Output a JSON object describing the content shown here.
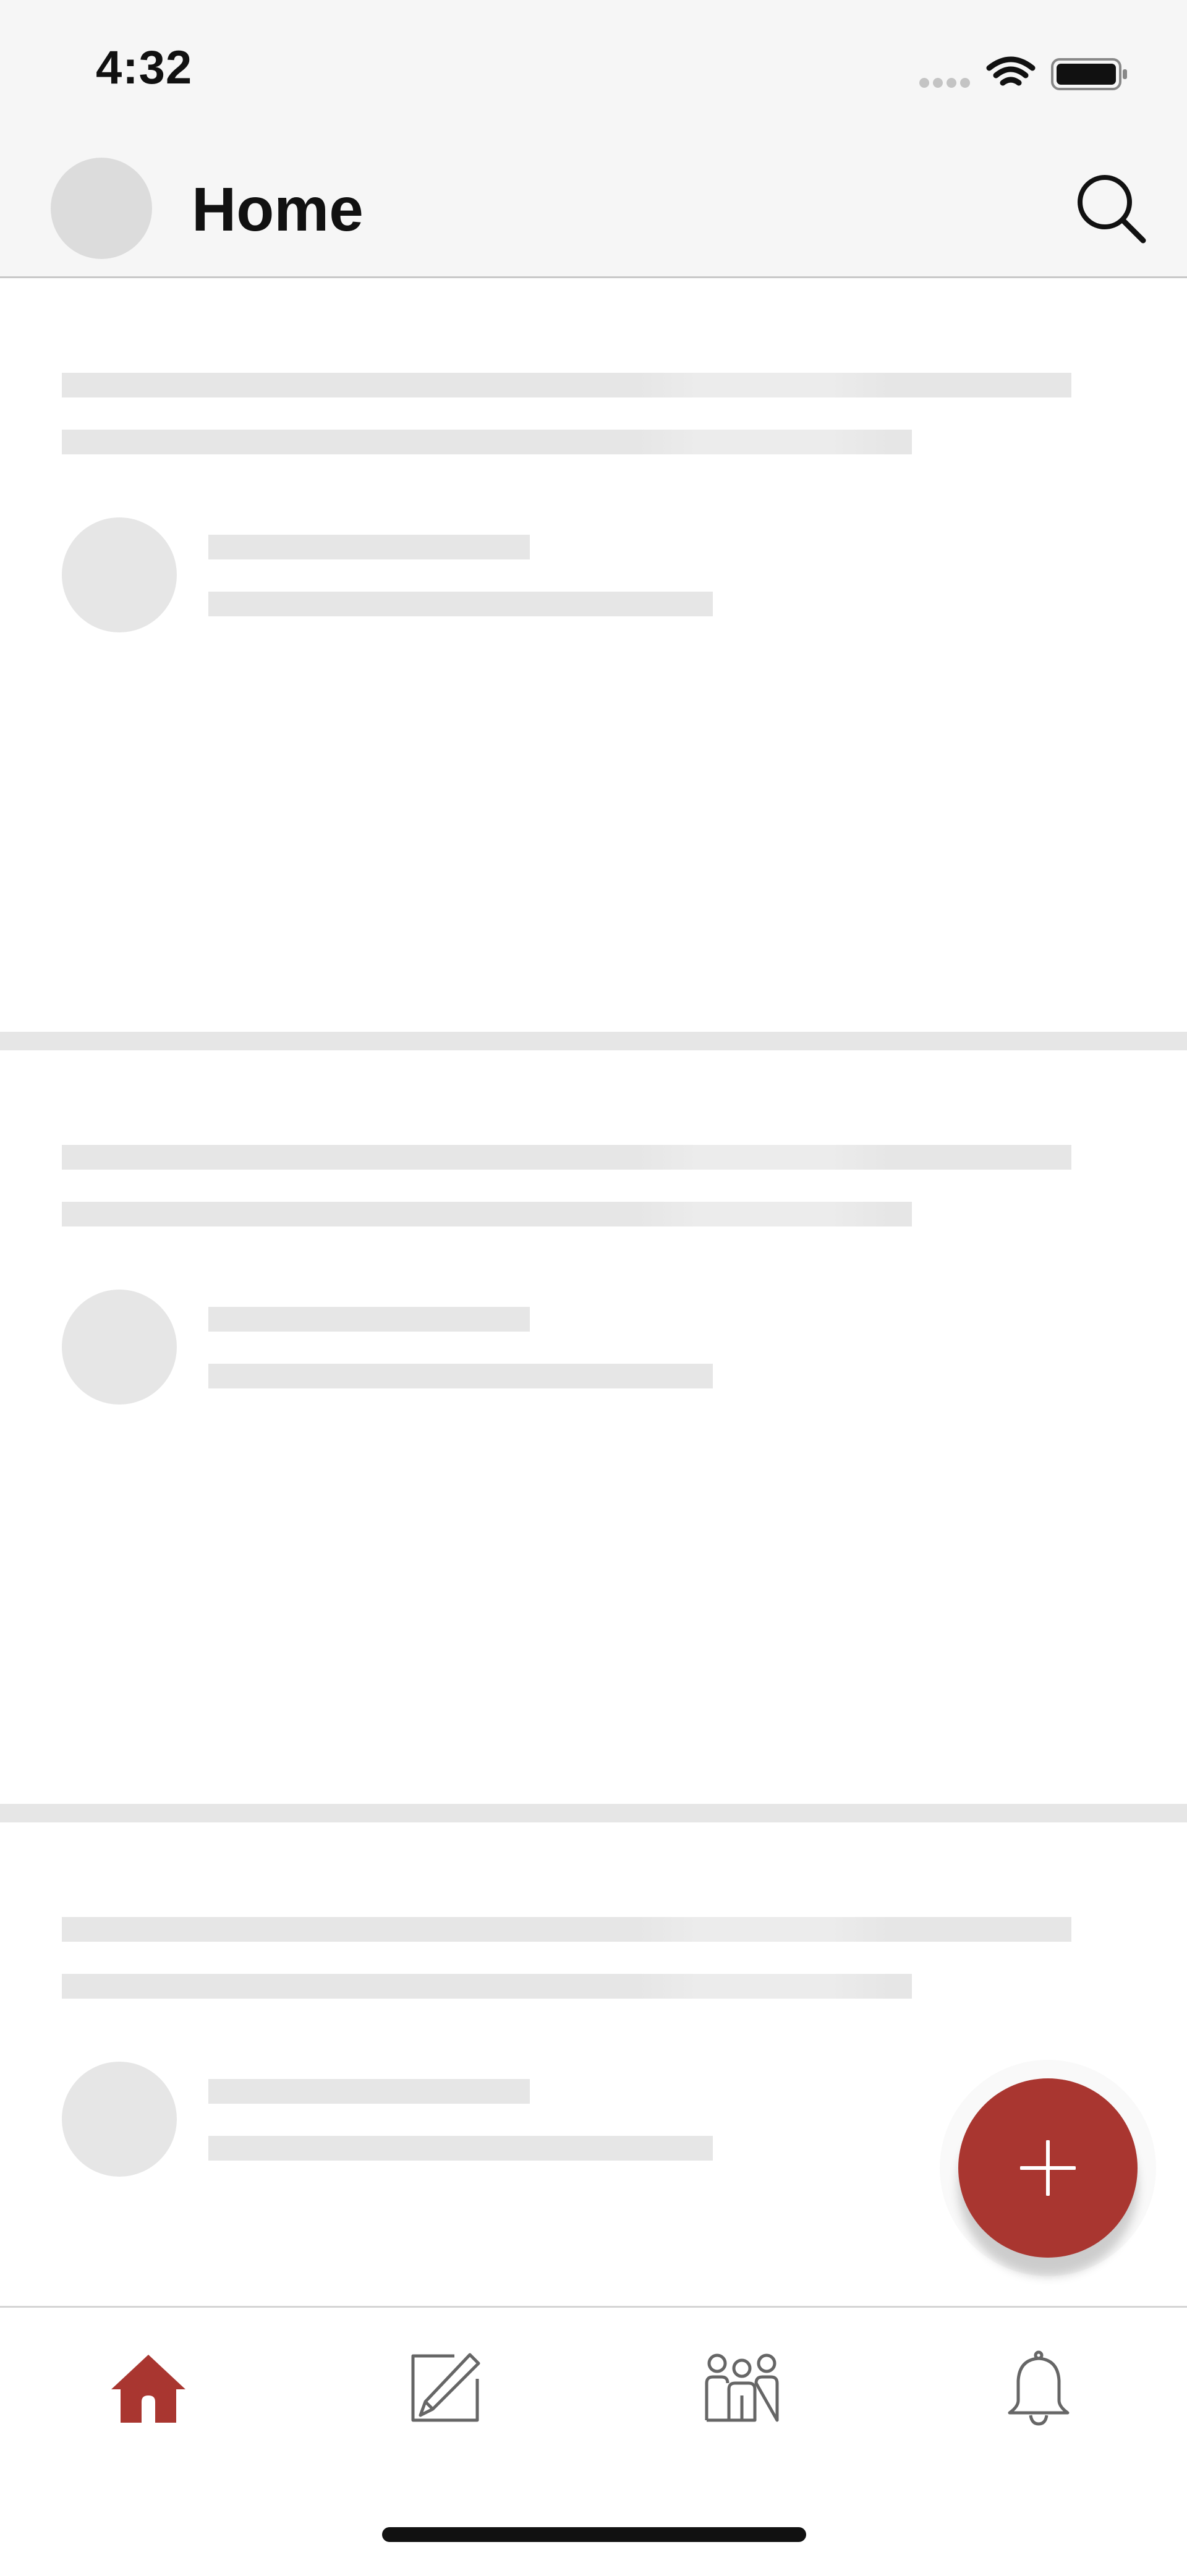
{
  "status_bar": {
    "time": "4:32",
    "icons": [
      "cellular-signal-icon",
      "wifi-icon",
      "battery-icon"
    ]
  },
  "header": {
    "title": "Home",
    "avatar_icon": "avatar-placeholder",
    "search_icon": "search-icon"
  },
  "feed": {
    "state": "loading",
    "skeleton_card_count": 3
  },
  "fab": {
    "icon": "plus-icon",
    "color": "#a93630"
  },
  "tab_bar": {
    "items": [
      {
        "name": "home",
        "icon": "home-icon",
        "active": true
      },
      {
        "name": "compose",
        "icon": "compose-icon",
        "active": false
      },
      {
        "name": "community",
        "icon": "people-icon",
        "active": false
      },
      {
        "name": "notifications",
        "icon": "bell-icon",
        "active": false
      }
    ],
    "active_color": "#a93630",
    "inactive_color": "#666666"
  },
  "colors": {
    "bar_background": "#f6f6f6",
    "skeleton": "#e6e6e6"
  }
}
